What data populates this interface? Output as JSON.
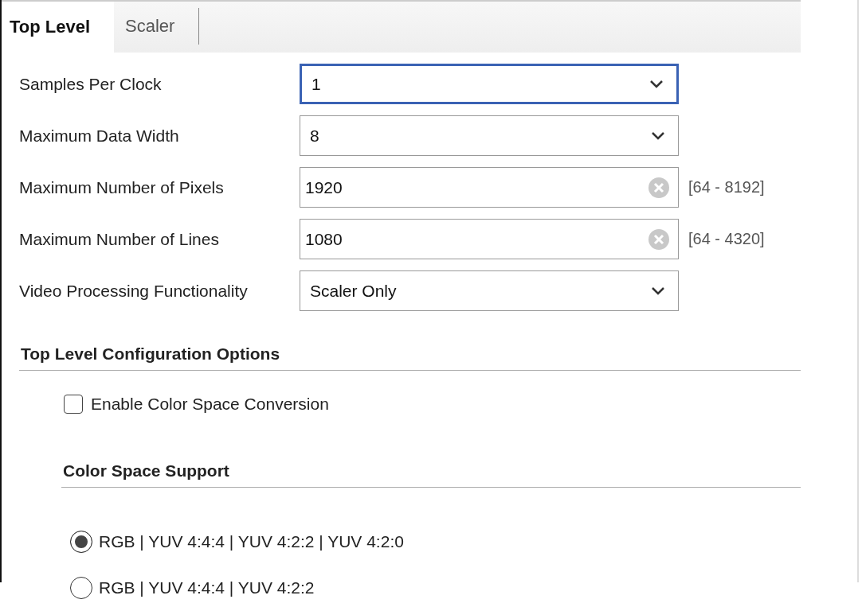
{
  "tabs": [
    {
      "label": "Top Level",
      "selected": true
    },
    {
      "label": "Scaler",
      "selected": false
    }
  ],
  "fields": [
    {
      "kind": "select",
      "label": "Samples Per Clock",
      "value": "1",
      "focused": true
    },
    {
      "kind": "select",
      "label": "Maximum Data Width",
      "value": "8",
      "focused": false
    },
    {
      "kind": "text",
      "label": "Maximum Number of Pixels",
      "value": "1920",
      "range": "[64 - 8192]",
      "focused": false
    },
    {
      "kind": "text",
      "label": "Maximum Number of Lines",
      "value": "1080",
      "range": "[64 - 4320]",
      "focused": false
    },
    {
      "kind": "select",
      "label": "Video Processing Functionality",
      "value": "Scaler Only",
      "focused": false
    }
  ],
  "section": {
    "title": "Top Level Configuration Options",
    "checkbox": {
      "label": "Enable Color Space Conversion",
      "checked": false
    },
    "subsection": {
      "title": "Color Space Support",
      "options": [
        {
          "label": "RGB | YUV 4:4:4 | YUV 4:2:2 | YUV 4:2:0",
          "selected": true
        },
        {
          "label": "RGB | YUV 4:4:4 | YUV 4:2:2",
          "selected": false
        }
      ]
    }
  }
}
